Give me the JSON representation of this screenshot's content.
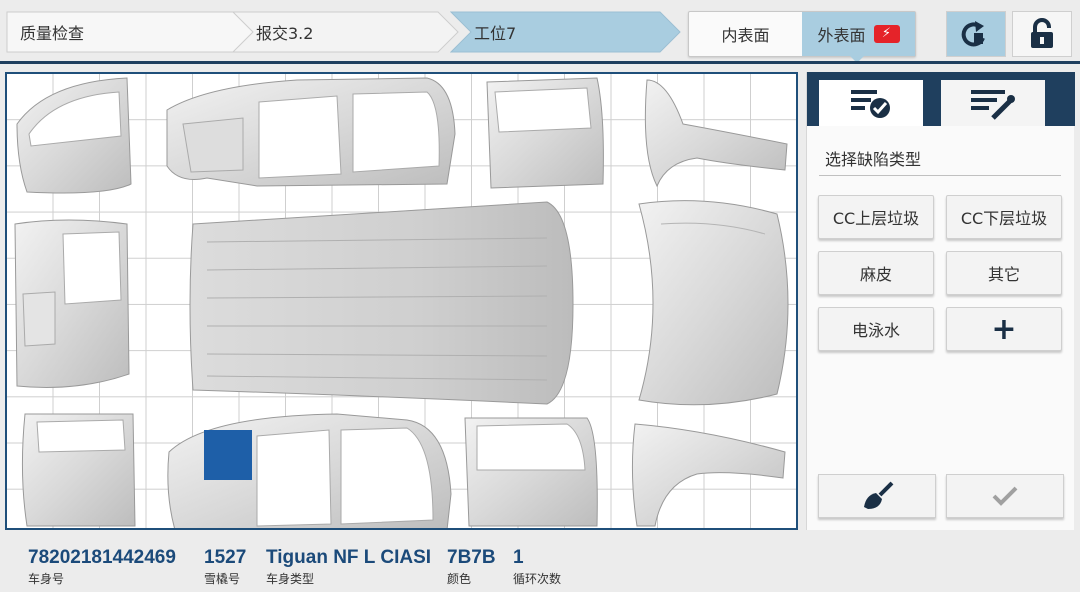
{
  "breadcrumb": [
    "质量检查",
    "报交3.2",
    "工位7"
  ],
  "surface_toggle": {
    "inner": "内表面",
    "outer": "外表面",
    "active": "outer"
  },
  "toolbar": {
    "rotate_icon": "rotate-view-icon",
    "lock_icon": "unlock-icon"
  },
  "panel": {
    "tabs": [
      {
        "icon": "defect-list-check-icon",
        "active": true
      },
      {
        "icon": "edit-tools-icon",
        "active": false
      }
    ],
    "title": "选择缺陷类型",
    "defects": [
      "CC上层垃圾",
      "CC下层垃圾",
      "麻皮",
      "其它",
      "电泳水"
    ],
    "add_label": "+",
    "actions": {
      "clear_icon": "broom-icon",
      "confirm_icon": "checkmark-icon"
    }
  },
  "vehicle": [
    {
      "value": "78202181442469",
      "label": "车身号"
    },
    {
      "value": "1527",
      "label": "雪橇号"
    },
    {
      "value": "Tiguan NF L CIASI",
      "label": "车身类型"
    },
    {
      "value": "7B7B",
      "label": "颜色"
    },
    {
      "value": "1",
      "label": "循环次数"
    }
  ],
  "colors": {
    "accent": "#1f3f5e",
    "active": "#a9cde0",
    "selection": "#1e5fa8",
    "value_text": "#1b4a7a",
    "alert": "#e52329"
  }
}
